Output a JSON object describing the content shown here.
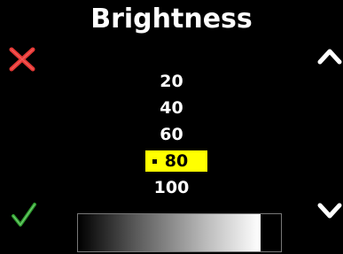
{
  "title": "Brightness",
  "icons": {
    "cancel": "cross-icon",
    "confirm": "checkmark-icon",
    "scroll_up": "chevron-up-icon",
    "scroll_down": "chevron-down-icon"
  },
  "options": [
    "20",
    "40",
    "60",
    "80",
    "100"
  ],
  "selected": {
    "index": 3,
    "label": "80"
  },
  "level_bar": {
    "fill_fraction": 0.9
  },
  "colors": {
    "background": "#000000",
    "text": "#ffffff",
    "highlight": "#ffff00",
    "cancel": "#e53935",
    "confirm": "#2e9e2e"
  }
}
